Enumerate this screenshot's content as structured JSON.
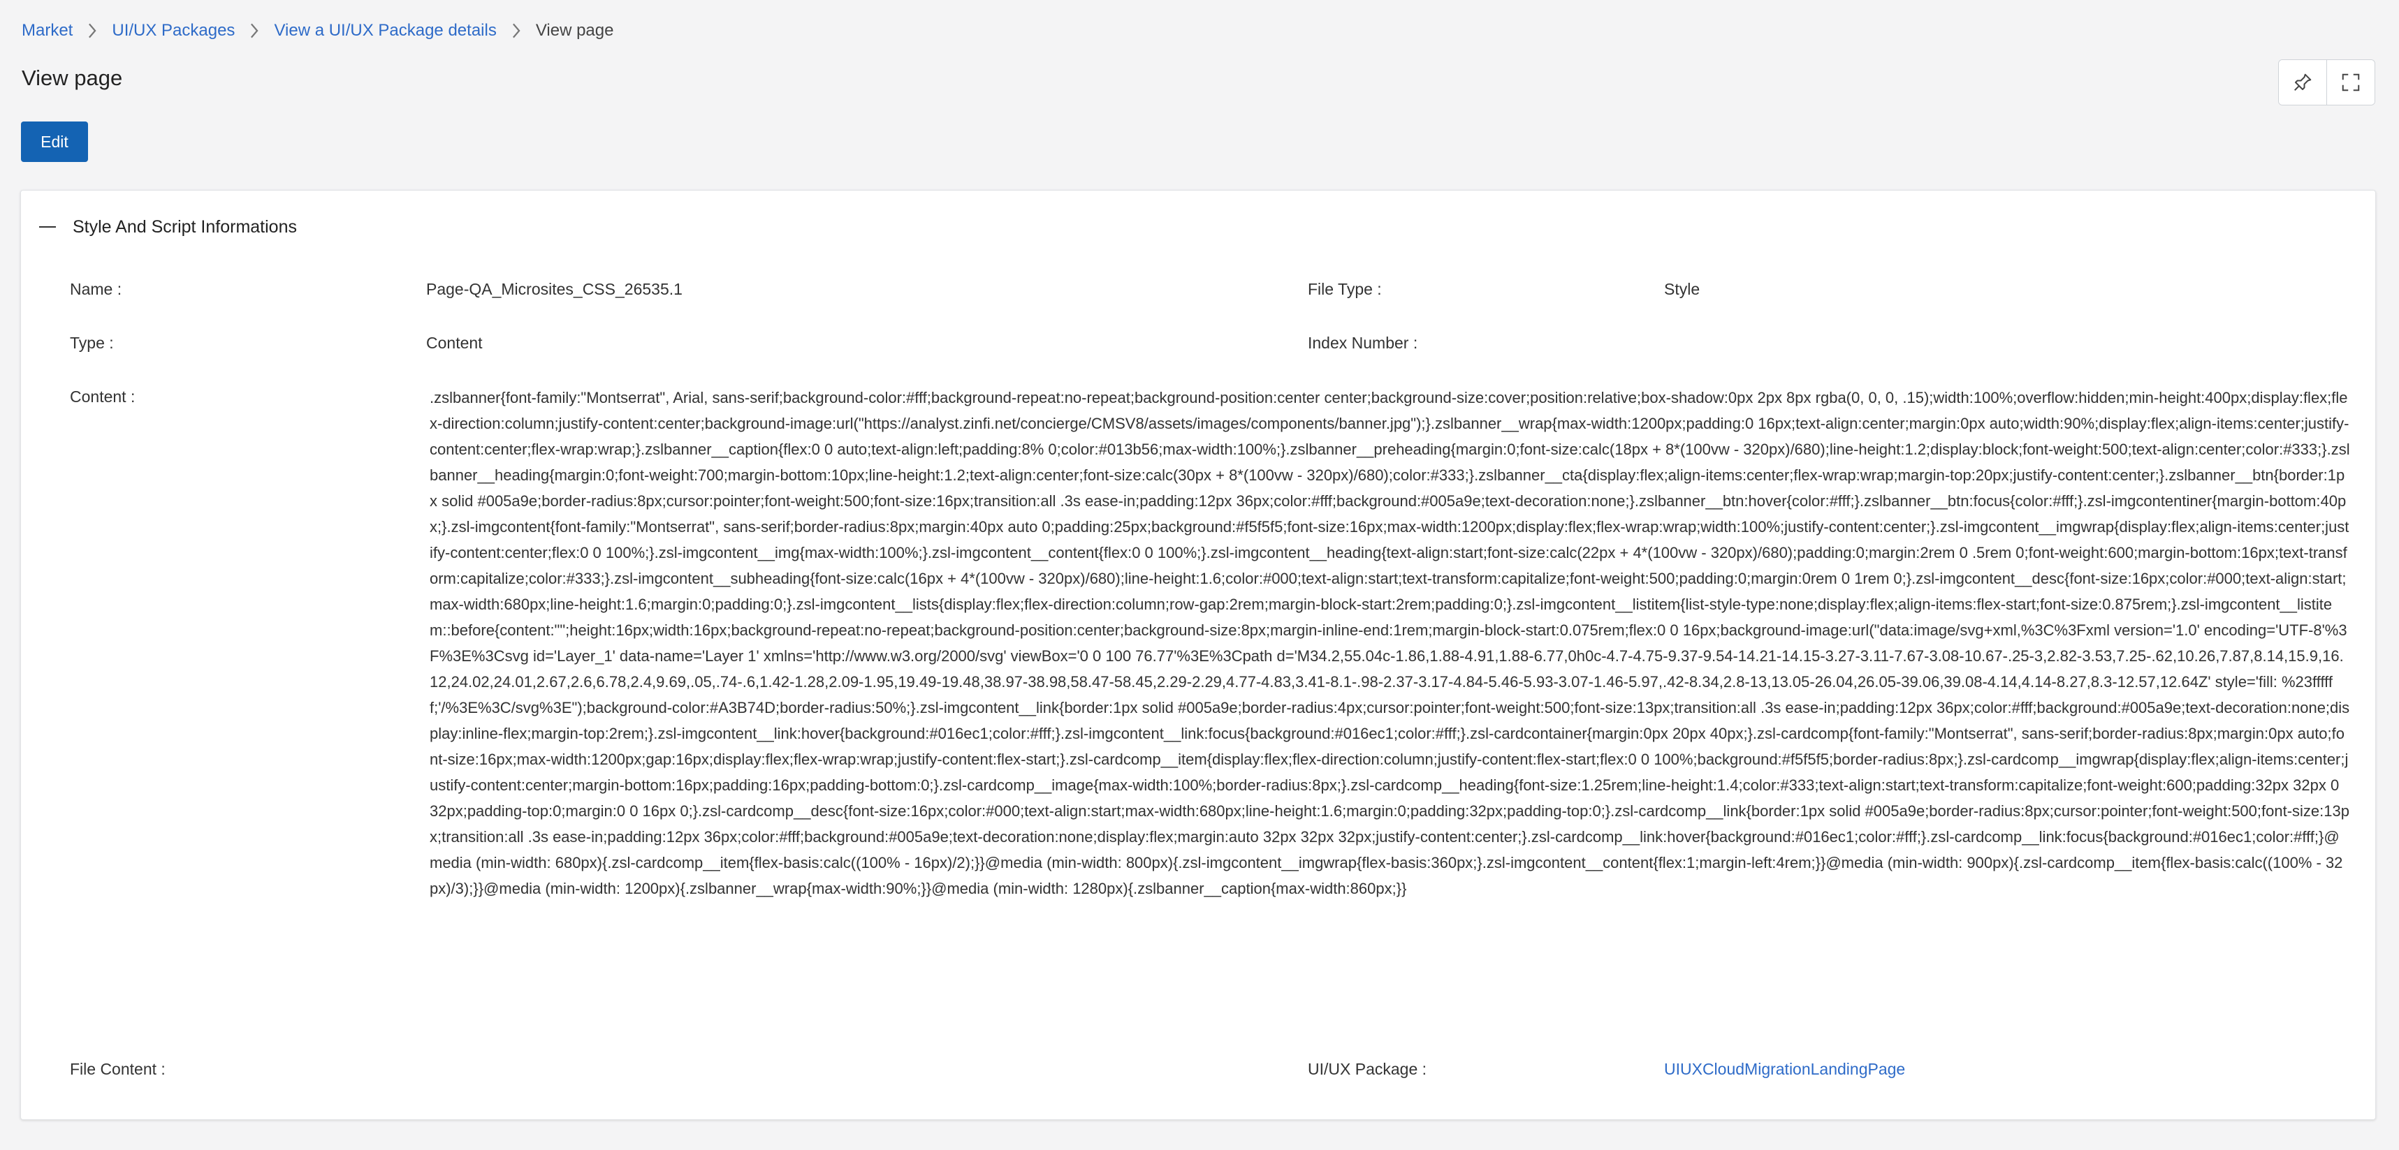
{
  "breadcrumb": {
    "items": [
      "Market",
      "UI/UX Packages",
      "View a UI/UX Package details"
    ],
    "current": "View page"
  },
  "page_title": "View page",
  "edit_button": "Edit",
  "panel": {
    "title": "Style And Script Informations",
    "name_label": "Name :",
    "name_value": "Page-QA_Microsites_CSS_26535.1",
    "file_type_label": "File Type :",
    "file_type_value": "Style",
    "type_label": "Type :",
    "type_value": "Content",
    "index_label": "Index Number :",
    "index_value": "",
    "content_label": "Content :",
    "content_value": ".zslbanner{font-family:\"Montserrat\", Arial, sans-serif;background-color:#fff;background-repeat:no-repeat;background-position:center center;background-size:cover;position:relative;box-shadow:0px 2px 8px rgba(0, 0, 0, .15);width:100%;overflow:hidden;min-height:400px;display:flex;flex-direction:column;justify-content:center;background-image:url(\"https://analyst.zinfi.net/concierge/CMSV8/assets/images/components/banner.jpg\");}.zslbanner__wrap{max-width:1200px;padding:0 16px;text-align:center;margin:0px auto;width:90%;display:flex;align-items:center;justify-content:center;flex-wrap:wrap;}.zslbanner__caption{flex:0 0 auto;text-align:left;padding:8% 0;color:#013b56;max-width:100%;}.zslbanner__preheading{margin:0;font-size:calc(18px + 8*(100vw - 320px)/680);line-height:1.2;display:block;font-weight:500;text-align:center;color:#333;}.zslbanner__heading{margin:0;font-weight:700;margin-bottom:10px;line-height:1.2;text-align:center;font-size:calc(30px + 8*(100vw - 320px)/680);color:#333;}.zslbanner__cta{display:flex;align-items:center;flex-wrap:wrap;margin-top:20px;justify-content:center;}.zslbanner__btn{border:1px solid #005a9e;border-radius:8px;cursor:pointer;font-weight:500;font-size:16px;transition:all .3s ease-in;padding:12px 36px;color:#fff;background:#005a9e;text-decoration:none;}.zslbanner__btn:hover{color:#fff;}.zslbanner__btn:focus{color:#fff;}.zsl-imgcontentiner{margin-bottom:40px;}.zsl-imgcontent{font-family:\"Montserrat\", sans-serif;border-radius:8px;margin:40px auto 0;padding:25px;background:#f5f5f5;font-size:16px;max-width:1200px;display:flex;flex-wrap:wrap;width:100%;justify-content:center;}.zsl-imgcontent__imgwrap{display:flex;align-items:center;justify-content:center;flex:0 0 100%;}.zsl-imgcontent__img{max-width:100%;}.zsl-imgcontent__content{flex:0 0 100%;}.zsl-imgcontent__heading{text-align:start;font-size:calc(22px + 4*(100vw - 320px)/680);padding:0;margin:2rem 0 .5rem 0;font-weight:600;margin-bottom:16px;text-transform:capitalize;color:#333;}.zsl-imgcontent__subheading{font-size:calc(16px + 4*(100vw - 320px)/680);line-height:1.6;color:#000;text-align:start;text-transform:capitalize;font-weight:500;padding:0;margin:0rem 0 1rem 0;}.zsl-imgcontent__desc{font-size:16px;color:#000;text-align:start;max-width:680px;line-height:1.6;margin:0;padding:0;}.zsl-imgcontent__lists{display:flex;flex-direction:column;row-gap:2rem;margin-block-start:2rem;padding:0;}.zsl-imgcontent__listitem{list-style-type:none;display:flex;align-items:flex-start;font-size:0.875rem;}.zsl-imgcontent__listitem::before{content:\"\";height:16px;width:16px;background-repeat:no-repeat;background-position:center;background-size:8px;margin-inline-end:1rem;margin-block-start:0.075rem;flex:0 0 16px;background-image:url(\"data:image/svg+xml,%3C%3Fxml version='1.0' encoding='UTF-8'%3F%3E%3Csvg id='Layer_1' data-name='Layer 1' xmlns='http://www.w3.org/2000/svg' viewBox='0 0 100 76.77'%3E%3Cpath d='M34.2,55.04c-1.86,1.88-4.91,1.88-6.77,0h0c-4.7-4.75-9.37-9.54-14.21-14.15-3.27-3.11-7.67-3.08-10.67-.25-3,2.82-3.53,7.25-.62,10.26,7.87,8.14,15.9,16.12,24.02,24.01,2.67,2.6,6.78,2.4,9.69,.05,.74-.6,1.42-1.28,2.09-1.95,19.49-19.48,38.97-38.98,58.47-58.45,2.29-2.29,4.77-4.83,3.41-8.1-.98-2.37-3.17-4.84-5.46-5.93-3.07-1.46-5.97,.42-8.34,2.8-13,13.05-26.04,26.05-39.06,39.08-4.14,4.14-8.27,8.3-12.57,12.64Z' style='fill: %23ffffff;'/%3E%3C/svg%3E\");background-color:#A3B74D;border-radius:50%;}.zsl-imgcontent__link{border:1px solid #005a9e;border-radius:4px;cursor:pointer;font-weight:500;font-size:13px;transition:all .3s ease-in;padding:12px 36px;color:#fff;background:#005a9e;text-decoration:none;display:inline-flex;margin-top:2rem;}.zsl-imgcontent__link:hover{background:#016ec1;color:#fff;}.zsl-imgcontent__link:focus{background:#016ec1;color:#fff;}.zsl-cardcontainer{margin:0px 20px 40px;}.zsl-cardcomp{font-family:\"Montserrat\", sans-serif;border-radius:8px;margin:0px auto;font-size:16px;max-width:1200px;gap:16px;display:flex;flex-wrap:wrap;justify-content:flex-start;}.zsl-cardcomp__item{display:flex;flex-direction:column;justify-content:flex-start;flex:0 0 100%;background:#f5f5f5;border-radius:8px;}.zsl-cardcomp__imgwrap{display:flex;align-items:center;justify-content:center;margin-bottom:16px;padding:16px;padding-bottom:0;}.zsl-cardcomp__image{max-width:100%;border-radius:8px;}.zsl-cardcomp__heading{font-size:1.25rem;line-height:1.4;color:#333;text-align:start;text-transform:capitalize;font-weight:600;padding:32px 32px 0 32px;padding-top:0;margin:0 0 16px 0;}.zsl-cardcomp__desc{font-size:16px;color:#000;text-align:start;max-width:680px;line-height:1.6;margin:0;padding:32px;padding-top:0;}.zsl-cardcomp__link{border:1px solid #005a9e;border-radius:8px;cursor:pointer;font-weight:500;font-size:13px;transition:all .3s ease-in;padding:12px 36px;color:#fff;background:#005a9e;text-decoration:none;display:flex;margin:auto 32px 32px 32px;justify-content:center;}.zsl-cardcomp__link:hover{background:#016ec1;color:#fff;}.zsl-cardcomp__link:focus{background:#016ec1;color:#fff;}@media (min-width: 680px){.zsl-cardcomp__item{flex-basis:calc((100% - 16px)/2);}}@media (min-width: 800px){.zsl-imgcontent__imgwrap{flex-basis:360px;}.zsl-imgcontent__content{flex:1;margin-left:4rem;}}@media (min-width: 900px){.zsl-cardcomp__item{flex-basis:calc((100% - 32px)/3);}}@media (min-width: 1200px){.zslbanner__wrap{max-width:90%;}}@media (min-width: 1280px){.zslbanner__caption{max-width:860px;}}",
    "file_content_label": "File Content :",
    "file_content_value": "",
    "package_label": "UI/UX Package :",
    "package_value": "UIUXCloudMigrationLandingPage"
  },
  "icons": {
    "pin": "pin-icon",
    "expand": "expand-icon",
    "collapse": "minus-icon",
    "separator": "chevron-right-icon"
  },
  "colors": {
    "link": "#2e6bc8",
    "primary_button": "#1463b3",
    "background": "#f4f4f5",
    "panel": "#ffffff"
  }
}
